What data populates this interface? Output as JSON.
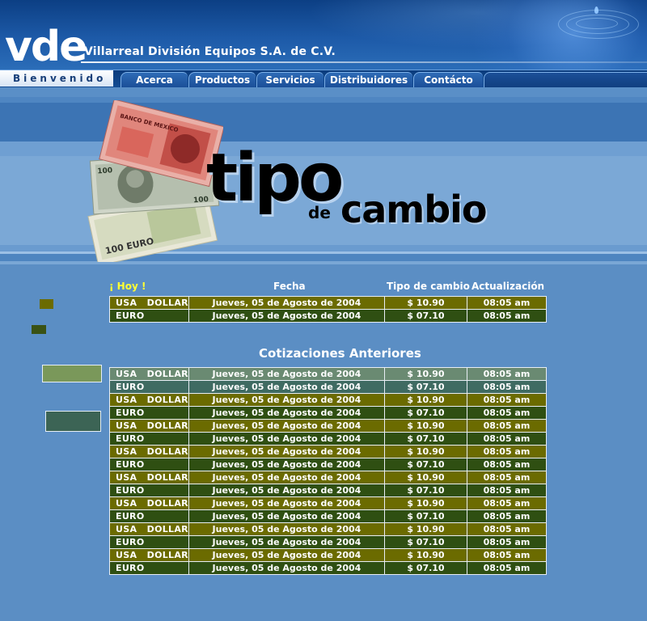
{
  "header": {
    "logo_text": "vde",
    "company_name": "Villarreal División Equipos S.A. de C.V."
  },
  "nav": {
    "welcome": "Bienvenido",
    "tabs": [
      "Acerca",
      "Productos",
      "Servicios",
      "Distribuidores",
      "Contácto"
    ]
  },
  "banner": {
    "title_main": "tipo",
    "title_small": "de",
    "title_second": "cambio",
    "bill_text": "BANCO DE MEXICO",
    "euro_text": "100 EURO"
  },
  "today": {
    "headers": {
      "hoy": "¡ Hoy !",
      "fecha": "Fecha",
      "tipo": "Tipo de cambio",
      "actualizacion": "Actualización"
    },
    "rows": [
      {
        "currency": "USA   DOLLAR",
        "date": "Jueves, 05 de Agosto de 2004",
        "rate": "$ 10.90",
        "time": "08:05 am"
      },
      {
        "currency": "EURO",
        "date": "Jueves, 05 de Agosto de 2004",
        "rate": "$ 07.10",
        "time": "08:05 am"
      }
    ]
  },
  "previous": {
    "title": "Cotizaciones Anteriores",
    "rows": [
      {
        "currency": "USA   DOLLAR",
        "date": "Jueves, 05 de Agosto de 2004",
        "rate": "$ 10.90",
        "time": "08:05 am"
      },
      {
        "currency": "EURO",
        "date": "Jueves, 05 de Agosto de 2004",
        "rate": "$ 07.10",
        "time": "08:05 am"
      },
      {
        "currency": "USA   DOLLAR",
        "date": "Jueves, 05 de Agosto de 2004",
        "rate": "$ 10.90",
        "time": "08:05 am"
      },
      {
        "currency": "EURO",
        "date": "Jueves, 05 de Agosto de 2004",
        "rate": "$ 07.10",
        "time": "08:05 am"
      },
      {
        "currency": "USA   DOLLAR",
        "date": "Jueves, 05 de Agosto de 2004",
        "rate": "$ 10.90",
        "time": "08:05 am"
      },
      {
        "currency": "EURO",
        "date": "Jueves, 05 de Agosto de 2004",
        "rate": "$ 07.10",
        "time": "08:05 am"
      },
      {
        "currency": "USA   DOLLAR",
        "date": "Jueves, 05 de Agosto de 2004",
        "rate": "$ 10.90",
        "time": "08:05 am"
      },
      {
        "currency": "EURO",
        "date": "Jueves, 05 de Agosto de 2004",
        "rate": "$ 07.10",
        "time": "08:05 am"
      },
      {
        "currency": "USA   DOLLAR",
        "date": "Jueves, 05 de Agosto de 2004",
        "rate": "$ 10.90",
        "time": "08:05 am"
      },
      {
        "currency": "EURO",
        "date": "Jueves, 05 de Agosto de 2004",
        "rate": "$ 07.10",
        "time": "08:05 am"
      },
      {
        "currency": "USA   DOLLAR",
        "date": "Jueves, 05 de Agosto de 2004",
        "rate": "$ 10.90",
        "time": "08:05 am"
      },
      {
        "currency": "EURO",
        "date": "Jueves, 05 de Agosto de 2004",
        "rate": "$ 07.10",
        "time": "08:05 am"
      },
      {
        "currency": "USA   DOLLAR",
        "date": "Jueves, 05 de Agosto de 2004",
        "rate": "$ 10.90",
        "time": "08:05 am"
      },
      {
        "currency": "EURO",
        "date": "Jueves, 05 de Agosto de 2004",
        "rate": "$ 07.10",
        "time": "08:05 am"
      },
      {
        "currency": "USA   DOLLAR",
        "date": "Jueves, 05 de Agosto de 2004",
        "rate": "$ 10.90",
        "time": "08:05 am"
      },
      {
        "currency": "EURO",
        "date": "Jueves, 05 de Agosto de 2004",
        "rate": "$ 07.10",
        "time": "08:05 am"
      }
    ]
  },
  "colors": {
    "usd_row": "#6b6b00",
    "euro_row": "#2f4f12",
    "usd_row_highlight": "#6a8a72",
    "euro_row_highlight": "#3f6b62",
    "page_background": "#5b8ec4",
    "hoy_label": "#ffff33"
  }
}
